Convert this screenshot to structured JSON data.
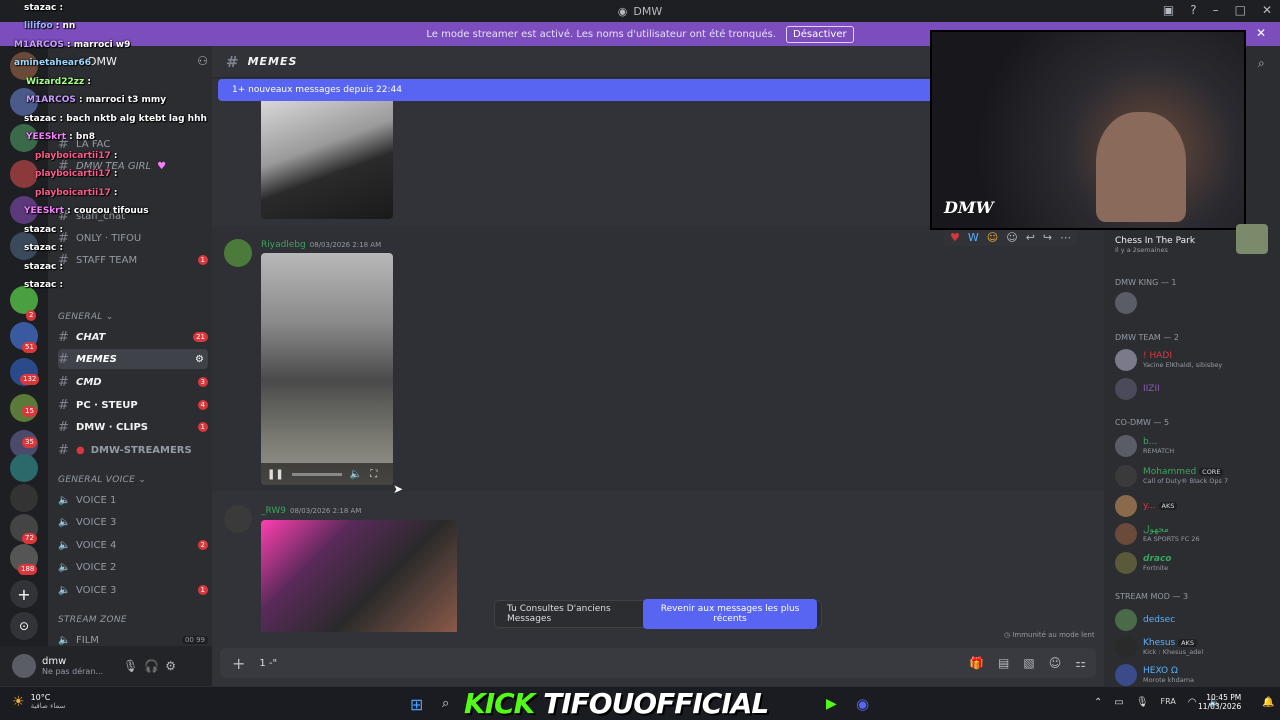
{
  "window": {
    "title": "DMW"
  },
  "banner": {
    "text": "Le mode streamer est activé. Les noms d'utilisateur ont été tronqués.",
    "button": "Désactiver"
  },
  "overlay_chat": [
    {
      "user": "stazac",
      "text": ""
    },
    {
      "user": "lilifoo",
      "text": "nn"
    },
    {
      "user": "M1ARCOS",
      "text": "marroci w9"
    },
    {
      "user": "aminetahear66",
      "text": ""
    },
    {
      "user": "Wizard22zz",
      "text": ""
    },
    {
      "user": "M1ARCOS",
      "text": "marroci t3 mmy"
    },
    {
      "user": "stazac",
      "text": "bach nktb alg ktebt lag hhh"
    },
    {
      "user": "YEESkrt",
      "text": "bn8"
    },
    {
      "user": "playboicartii17",
      "text": ""
    },
    {
      "user": "playboicartii17",
      "text": ""
    },
    {
      "user": "playboicartii17",
      "text": ""
    },
    {
      "user": "YEESkrt",
      "text": "coucou tifouus"
    },
    {
      "user": "stazac",
      "text": ""
    },
    {
      "user": "stazac",
      "text": ""
    },
    {
      "user": "stazac",
      "text": ""
    },
    {
      "user": "stazac",
      "text": ""
    }
  ],
  "server": {
    "name": "DMW"
  },
  "channels": {
    "top": [
      {
        "name": "LA FAC"
      },
      {
        "name": "DMW TEA GIRL"
      },
      {
        "name": "staff_chat"
      },
      {
        "name": "ONLY · TIFOU"
      },
      {
        "name": "STAFF TEAM",
        "count": "1"
      }
    ],
    "general_label": "GENERAL",
    "general": [
      {
        "name": "CHAT",
        "count": "21"
      },
      {
        "name": "MEMES",
        "count": ""
      },
      {
        "name": "CMD",
        "count": "3"
      },
      {
        "name": "PC · STEUP",
        "count": "4"
      },
      {
        "name": "DMW · CLIPS",
        "count": "1"
      },
      {
        "name": "DMW-STREAMERS",
        "count": ""
      }
    ],
    "voice_label": "GENERAL VOICE",
    "voice": [
      {
        "name": "VOICE 1",
        "count": ""
      },
      {
        "name": "VOICE 3",
        "count": ""
      },
      {
        "name": "VOICE 4",
        "count": "2"
      },
      {
        "name": "VOICE 2",
        "count": ""
      },
      {
        "name": "VOICE 3",
        "count": "1"
      }
    ],
    "stream_label": "STREAM ZONE",
    "stream": [
      {
        "name": "FILM",
        "count": "00 99"
      }
    ]
  },
  "user_panel": {
    "name": "dmw",
    "status": "Ne pas déran..."
  },
  "chat": {
    "channel_name": "MEMES",
    "new_messages": "1+ nouveaux messages depuis 22:44",
    "messages": [
      {
        "author": "Riyadlebg",
        "time": "08/03/2026 2:18 AM"
      },
      {
        "author": "_RW9",
        "time": "08/03/2026 2:18 AM"
      }
    ],
    "toast_text": "Tu Consultes D'anciens Messages",
    "toast_button": "Revenir aux messages les plus récents",
    "slowmode": "Immunité au mode lent",
    "composer_text": "1 -\""
  },
  "members": {
    "activity": {
      "name": "Chess In The Park",
      "time": "Il y a 2semaines"
    },
    "groups": [
      {
        "label": "DMW KING — 1",
        "members": [
          {
            "name": "",
            "status": ""
          }
        ]
      },
      {
        "label": "DMW TEAM — 2",
        "members": [
          {
            "name": "! HADI",
            "status": "Yacine ElKhaldi, sibisbey"
          },
          {
            "name": "IIZII",
            "status": ""
          }
        ]
      },
      {
        "label": "CO-DMW — 5",
        "members": [
          {
            "name": "b...",
            "status": "REMATCH"
          },
          {
            "name": "Mohammed",
            "status": "Call of Duty® Black Ops 7",
            "tag": "CORE"
          },
          {
            "name": "y...",
            "status": "",
            "tag": "AKS"
          },
          {
            "name": "مجهول",
            "status": "EA SPORTS FC 26"
          },
          {
            "name": "draco",
            "status": "Fortnite"
          }
        ]
      },
      {
        "label": "STREAM MOD — 3",
        "members": [
          {
            "name": "dedsec",
            "status": ""
          },
          {
            "name": "Khesus",
            "status": "Kick : Khesus_adel",
            "tag": "AKS"
          },
          {
            "name": "HEXO Ω",
            "status": "Morote khdama"
          }
        ]
      }
    ]
  },
  "stream_overlay": {
    "kick": "KICK",
    "channel": "TIFOUOFFICIAL",
    "webcam_tag": "DMW"
  },
  "taskbar": {
    "weather": "10°C",
    "weather_desc": "سماء صافية",
    "lang": "FRA",
    "time": "10:45 PM",
    "date": "11/03/2026"
  },
  "colors": {
    "accent": "#5865f2",
    "banner": "#7c4dbd",
    "kick_green": "#53fc18"
  }
}
